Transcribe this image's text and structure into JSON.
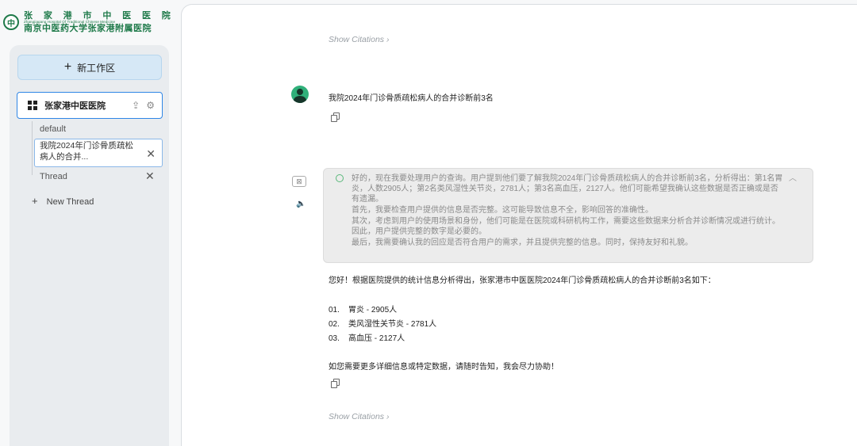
{
  "logo": {
    "seal": "中",
    "line1": "张 家 港 市 中 医 医 院",
    "line_en": "Zhangjiagang Hospital Of Traditional Chinese Medicine",
    "line2": "南京中医药大学张家港附属医院"
  },
  "sidebar": {
    "new_workspace_label": "新工作区",
    "workspace": {
      "name": "张家港中医医院",
      "upload_icon": "upload-icon",
      "settings_icon": "gear-icon"
    },
    "threads": [
      {
        "label": "default"
      },
      {
        "label": "我院2024年门诊骨质疏松病人的合并...",
        "active": true
      },
      {
        "label": "Thread"
      }
    ],
    "new_thread_label": "New Thread"
  },
  "chat": {
    "show_citations": "Show Citations",
    "user_message": "我院2024年门诊骨质疏松病人的合并诊断前3名",
    "thinking": [
      "好的，现在我要处理用户的查询。用户提到他们要了解我院2024年门诊骨质疏松病人的合并诊断前3名，分析得出：第1名胃炎，人数2905人；第2名类风湿性关节炎，2781人；第3名高血压，2127人。他们可能希望我确认这些数据是否正确或是否有遗漏。",
      "首先，我要检查用户提供的信息是否完整。这可能导致信息不全，影响回答的准确性。",
      "其次，考虑到用户的使用场景和身份，他们可能是在医院或科研机构工作，需要这些数据来分析合并诊断情况或进行统计。因此，用户提供完整的数字是必要的。",
      "最后，我需要确认我的回应是否符合用户的需求，并且提供完整的信息。同时，保持友好和礼貌。"
    ],
    "answer_intro": "您好！根据医院提供的统计信息分析得出，张家港市中医医院2024年门诊骨质疏松病人的合并诊断前3名如下：",
    "answer_items": [
      {
        "num": "01.",
        "text": "胃炎 - 2905人"
      },
      {
        "num": "02.",
        "text": "类风湿性关节炎 - 2781人"
      },
      {
        "num": "03.",
        "text": "高血压 - 2127人"
      }
    ],
    "answer_outro": "如您需要更多详细信息或特定数据，请随时告知，我会尽力协助！"
  }
}
